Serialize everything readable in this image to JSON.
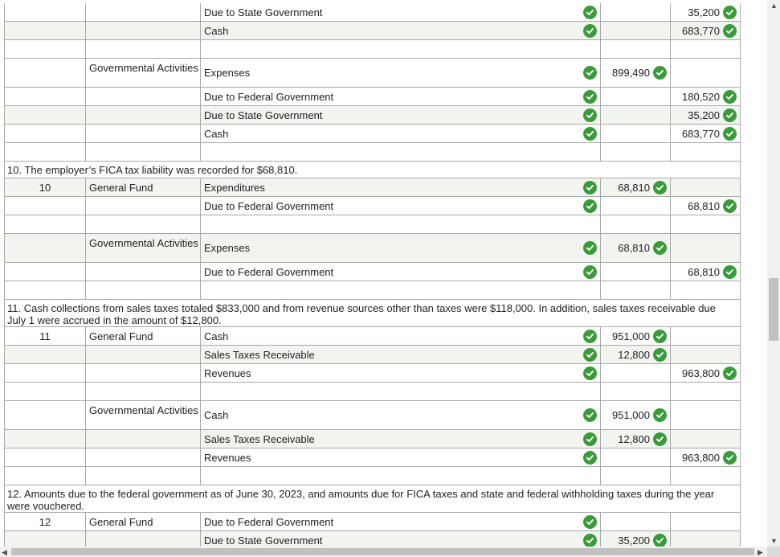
{
  "rows": [
    {
      "type": "entry",
      "num": "",
      "fund": "",
      "account": "Due to State Government",
      "acct_check": true,
      "debit": "",
      "credit": "35,200",
      "h": 23
    },
    {
      "type": "entry",
      "num": "",
      "fund": "",
      "account": "Cash",
      "acct_check": true,
      "debit": "",
      "credit": "683,770",
      "h": 23,
      "shaded": true
    },
    {
      "type": "entry",
      "num": "",
      "fund": "",
      "account": "",
      "acct_check": false,
      "debit": "",
      "credit": "",
      "h": 23
    },
    {
      "type": "entry",
      "num": "",
      "fund": "Governmental Activities",
      "account": "Expenses",
      "acct_check": true,
      "debit": "899,490",
      "credit": "",
      "h": 36
    },
    {
      "type": "entry",
      "num": "",
      "fund": "",
      "account": "Due to Federal Government",
      "acct_check": true,
      "debit": "",
      "credit": "180,520",
      "h": 23
    },
    {
      "type": "entry",
      "num": "",
      "fund": "",
      "account": "Due to State Government",
      "acct_check": true,
      "debit": "",
      "credit": "35,200",
      "h": 23,
      "shaded": true
    },
    {
      "type": "entry",
      "num": "",
      "fund": "",
      "account": "Cash",
      "acct_check": true,
      "debit": "",
      "credit": "683,770",
      "h": 23
    },
    {
      "type": "entry",
      "num": "",
      "fund": "",
      "account": "",
      "acct_check": false,
      "debit": "",
      "credit": "",
      "h": 23
    },
    {
      "type": "desc",
      "text": "10. The employer’s FICA tax liability was recorded for $68,810.",
      "h": 21
    },
    {
      "type": "entry",
      "num": "10",
      "fund": "General Fund",
      "account": "Expenditures",
      "acct_check": true,
      "debit": "68,810",
      "credit": "",
      "h": 23,
      "shaded": true
    },
    {
      "type": "entry",
      "num": "",
      "fund": "",
      "account": "Due to Federal Government",
      "acct_check": true,
      "debit": "",
      "credit": "68,810",
      "h": 23
    },
    {
      "type": "entry",
      "num": "",
      "fund": "",
      "account": "",
      "acct_check": false,
      "debit": "",
      "credit": "",
      "h": 23
    },
    {
      "type": "entry",
      "num": "",
      "fund": "Governmental Activities",
      "account": "Expenses",
      "acct_check": true,
      "debit": "68,810",
      "credit": "",
      "h": 36,
      "shaded": true
    },
    {
      "type": "entry",
      "num": "",
      "fund": "",
      "account": "Due to Federal Government",
      "acct_check": true,
      "debit": "",
      "credit": "68,810",
      "h": 23
    },
    {
      "type": "entry",
      "num": "",
      "fund": "",
      "account": "",
      "acct_check": false,
      "debit": "",
      "credit": "",
      "h": 23
    },
    {
      "type": "desc",
      "text": "11. Cash collections from sales taxes totaled $833,000 and from revenue sources other than taxes were $118,000. In addition, sales taxes receivable due July 1 were accrued in the amount of $12,800.",
      "h": 34
    },
    {
      "type": "entry",
      "num": "11",
      "fund": "General Fund",
      "account": "Cash",
      "acct_check": true,
      "debit": "951,000",
      "credit": "",
      "h": 23
    },
    {
      "type": "entry",
      "num": "",
      "fund": "",
      "account": "Sales Taxes Receivable",
      "acct_check": true,
      "debit": "12,800",
      "credit": "",
      "h": 23,
      "shaded": true
    },
    {
      "type": "entry",
      "num": "",
      "fund": "",
      "account": "Revenues",
      "acct_check": true,
      "debit": "",
      "credit": "963,800",
      "h": 23
    },
    {
      "type": "entry",
      "num": "",
      "fund": "",
      "account": "",
      "acct_check": false,
      "debit": "",
      "credit": "",
      "h": 23
    },
    {
      "type": "entry",
      "num": "",
      "fund": "Governmental Activities",
      "account": "Cash",
      "acct_check": true,
      "debit": "951,000",
      "credit": "",
      "h": 36
    },
    {
      "type": "entry",
      "num": "",
      "fund": "",
      "account": "Sales Taxes Receivable",
      "acct_check": true,
      "debit": "12,800",
      "credit": "",
      "h": 23,
      "shaded": true
    },
    {
      "type": "entry",
      "num": "",
      "fund": "",
      "account": "Revenues",
      "acct_check": true,
      "debit": "",
      "credit": "963,800",
      "h": 23
    },
    {
      "type": "entry",
      "num": "",
      "fund": "",
      "account": "",
      "acct_check": false,
      "debit": "",
      "credit": "",
      "h": 23
    },
    {
      "type": "desc",
      "text": "12. Amounts due to the federal government as of June 30, 2023, and amounts due for FICA taxes and state and federal withholding taxes during the year were vouchered.",
      "h": 34
    },
    {
      "type": "entry",
      "num": "12",
      "fund": "General Fund",
      "account": "Due to Federal Government",
      "acct_check": true,
      "debit": "",
      "credit": "",
      "h": 23
    },
    {
      "type": "entry",
      "num": "",
      "fund": "",
      "account": "Due to State Government",
      "acct_check": true,
      "debit": "35,200",
      "credit": "",
      "h": 23,
      "shaded": true
    }
  ],
  "colors": {
    "check": "#3a9b3a",
    "shade": "#f2f5ef",
    "border": "#a9a9a9"
  },
  "icons": {
    "check": "check-circle-icon",
    "scroll_up": "scroll-up-arrow-icon",
    "scroll_down": "scroll-down-arrow-icon",
    "scroll_left": "scroll-left-arrow-icon",
    "scroll_right": "scroll-right-arrow-icon"
  },
  "scroll": {
    "up": "▲",
    "down": "▼",
    "left": "◀",
    "right": "▶"
  }
}
